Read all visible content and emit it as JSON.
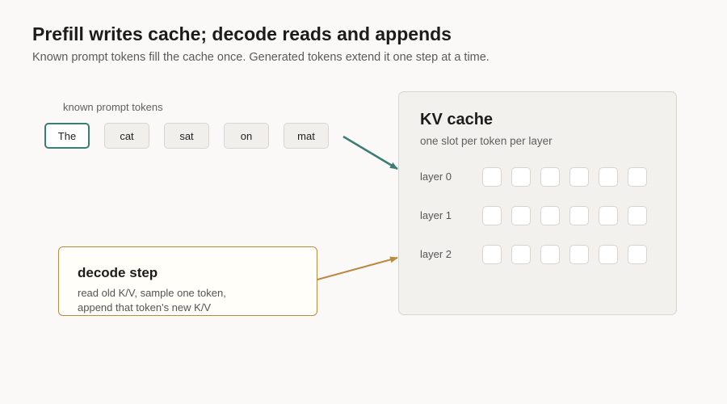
{
  "header": {
    "title": "Prefill writes cache; decode reads and appends",
    "subtitle": "Known prompt tokens fill the cache once. Generated tokens extend it one step at a time."
  },
  "prompt": {
    "label": "known prompt tokens",
    "tokens": [
      "The",
      "cat",
      "sat",
      "on",
      "mat"
    ]
  },
  "cache": {
    "title": "KV cache",
    "subtitle": "one slot per token per layer",
    "layers": [
      "layer 0",
      "layer 1",
      "layer 2"
    ],
    "slots_per_layer": 6
  },
  "decode": {
    "title": "decode step",
    "line1": "read old K/V, sample one token,",
    "line2": "append that token's new K/V"
  },
  "colors": {
    "prefill_arrow": "#3b7d74",
    "decode_arrow": "#b98a40"
  }
}
